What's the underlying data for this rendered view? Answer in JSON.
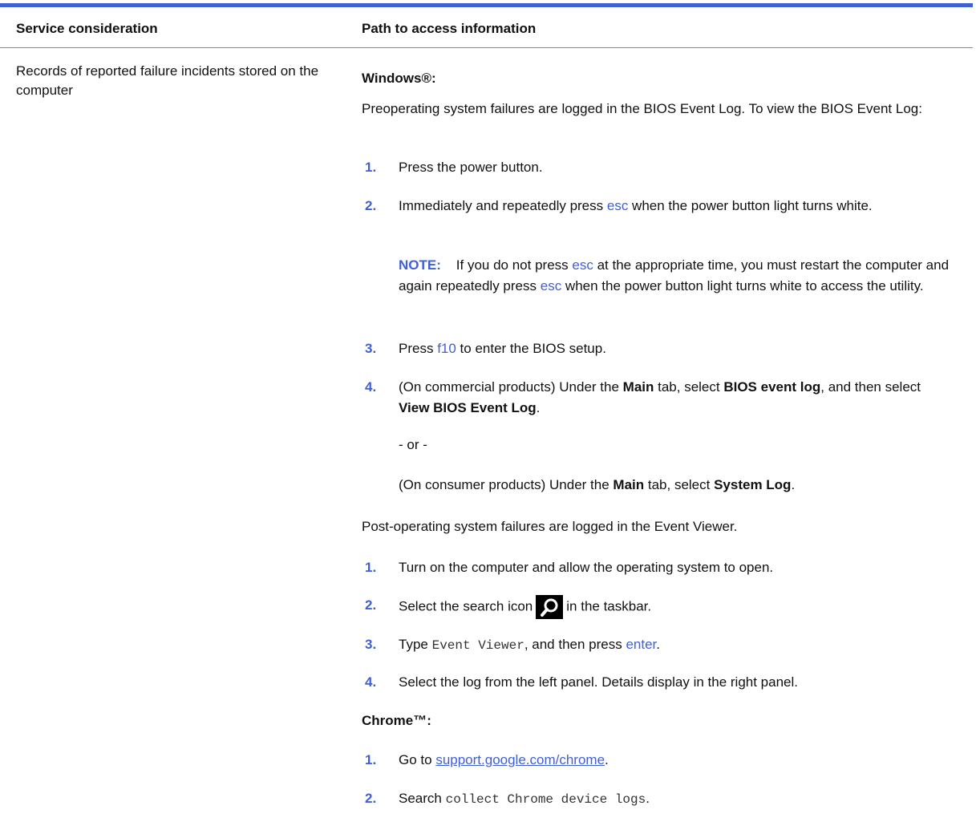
{
  "colors": {
    "accent": "#3f5fd6",
    "text": "#111111"
  },
  "header": {
    "col1": "Service consideration",
    "col2": "Path to access information"
  },
  "row": {
    "consideration": "Records of reported failure incidents stored on the computer",
    "windows": {
      "heading": "Windows®:",
      "intro": "Preoperating system failures are logged in the BIOS Event Log. To view the BIOS Event Log:",
      "steps_bios": [
        {
          "num": "1.",
          "text": "Press the power button."
        },
        {
          "num": "2.",
          "pre": "Immediately and repeatedly press ",
          "key": "esc",
          "post": " when the power button light turns white."
        },
        {
          "note_label": "NOTE:",
          "note_a": "If you do not press ",
          "note_key1": "esc",
          "note_b": " at the appropriate time, you must restart the computer and again repeatedly press ",
          "note_key2": "esc",
          "note_c": " when the power button light turns white to access the utility."
        },
        {
          "num": "3.",
          "pre": "Press ",
          "key": "f10",
          "post": " to enter the BIOS setup."
        },
        {
          "num": "4.",
          "a": "(On commercial products) Under the ",
          "b1": "Main",
          "c": " tab, select ",
          "b2": "BIOS event log",
          "d": ", and then select ",
          "b3": "View BIOS Event Log",
          "e": "."
        },
        {
          "or": "- or -"
        },
        {
          "a": "(On consumer products) Under the ",
          "b1": "Main",
          "c": " tab, select ",
          "b2": "System Log",
          "e": "."
        }
      ],
      "post_intro": "Post-operating system failures are logged in the Event Viewer.",
      "steps_viewer": [
        {
          "num": "1.",
          "text": "Turn on the computer and allow the operating system to open."
        },
        {
          "num": "2.",
          "pre": "Select the search icon",
          "post": "in the taskbar.",
          "icon": "search-icon"
        },
        {
          "num": "3.",
          "pre": "Type ",
          "code": "Event Viewer",
          "mid": ", and then press ",
          "key": "enter",
          "post": "."
        },
        {
          "num": "4.",
          "text": "Select the log from the left panel. Details display in the right panel."
        }
      ]
    },
    "chrome": {
      "heading": "Chrome™:",
      "steps": [
        {
          "num": "1.",
          "pre": "Go to ",
          "link": "support.google.com/chrome",
          "post": "."
        },
        {
          "num": "2.",
          "pre": "Search ",
          "code": "collect Chrome device logs",
          "post": "."
        }
      ]
    }
  }
}
